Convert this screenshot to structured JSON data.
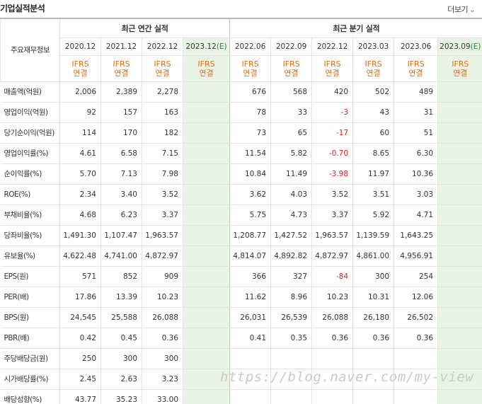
{
  "header": {
    "title": "기업실적분석",
    "more_label": "더보기",
    "more_icon": "chevron-down-icon"
  },
  "table": {
    "row_header": "주요재무정보",
    "group_annual": "최근 연간 실적",
    "group_quarterly": "최근 분기 실적",
    "annual_periods": [
      "2020.12",
      "2021.12",
      "2022.12",
      "2023.12"
    ],
    "annual_estimate_mark": "(E)",
    "quarterly_periods": [
      "2022.06",
      "2022.09",
      "2022.12",
      "2023.03",
      "2023.06",
      "2023.09"
    ],
    "quarterly_estimate_mark": "(E)",
    "ifrs_line1": "IFRS",
    "ifrs_line2": "연결",
    "rows": [
      {
        "label": "매출액(억원)",
        "annual": [
          "2,006",
          "2,389",
          "2,278",
          ""
        ],
        "quarterly": [
          "676",
          "568",
          "420",
          "502",
          "489",
          ""
        ]
      },
      {
        "label": "영업이익(억원)",
        "annual": [
          "92",
          "157",
          "163",
          ""
        ],
        "quarterly": [
          "78",
          "33",
          "-3",
          "43",
          "31",
          ""
        ]
      },
      {
        "label": "당기순이익(억원)",
        "annual": [
          "114",
          "170",
          "182",
          ""
        ],
        "quarterly": [
          "73",
          "65",
          "-17",
          "60",
          "51",
          ""
        ]
      },
      {
        "label": "영업이익률(%)",
        "annual": [
          "4.61",
          "6.58",
          "7.15",
          ""
        ],
        "quarterly": [
          "11.54",
          "5.82",
          "-0.70",
          "8.65",
          "6.30",
          ""
        ]
      },
      {
        "label": "순이익률(%)",
        "annual": [
          "5.70",
          "7.13",
          "7.98",
          ""
        ],
        "quarterly": [
          "10.84",
          "11.49",
          "-3.98",
          "11.97",
          "10.36",
          ""
        ]
      },
      {
        "label": "ROE(%)",
        "annual": [
          "2.34",
          "3.40",
          "3.52",
          ""
        ],
        "quarterly": [
          "3.62",
          "4.03",
          "3.52",
          "3.51",
          "3.03",
          ""
        ]
      },
      {
        "label": "부채비율(%)",
        "annual": [
          "4.68",
          "6.23",
          "3.37",
          ""
        ],
        "quarterly": [
          "5.75",
          "4.73",
          "3.37",
          "5.92",
          "4.71",
          ""
        ]
      },
      {
        "label": "당좌비율(%)",
        "annual": [
          "1,491.30",
          "1,107.47",
          "1,963.57",
          ""
        ],
        "quarterly": [
          "1,208.77",
          "1,427.52",
          "1,963.57",
          "1,139.59",
          "1,643.25",
          ""
        ]
      },
      {
        "label": "유보율(%)",
        "annual": [
          "4,622.48",
          "4,741.00",
          "4,872.97",
          ""
        ],
        "quarterly": [
          "4,814.07",
          "4,892.82",
          "4,872.97",
          "4,861.00",
          "4,956.91",
          ""
        ]
      },
      {
        "label": "EPS(원)",
        "annual": [
          "571",
          "852",
          "909",
          ""
        ],
        "quarterly": [
          "366",
          "327",
          "-84",
          "300",
          "254",
          ""
        ]
      },
      {
        "label": "PER(배)",
        "annual": [
          "17.86",
          "13.39",
          "10.23",
          ""
        ],
        "quarterly": [
          "11.62",
          "8.96",
          "10.23",
          "10.31",
          "12.06",
          ""
        ]
      },
      {
        "label": "BPS(원)",
        "annual": [
          "24,545",
          "25,588",
          "26,088",
          ""
        ],
        "quarterly": [
          "26,031",
          "26,539",
          "26,088",
          "26,180",
          "26,502",
          ""
        ]
      },
      {
        "label": "PBR(배)",
        "annual": [
          "0.42",
          "0.45",
          "0.36",
          ""
        ],
        "quarterly": [
          "0.41",
          "0.35",
          "0.36",
          "0.36",
          "0.36",
          ""
        ]
      },
      {
        "label": "주당배당금(원)",
        "annual": [
          "250",
          "300",
          "300",
          ""
        ],
        "quarterly": [
          "",
          "",
          "",
          "",
          "",
          ""
        ]
      },
      {
        "label": "시가배당률(%)",
        "annual": [
          "2.45",
          "2.63",
          "3.23",
          ""
        ],
        "quarterly": [
          "",
          "",
          "",
          "",
          "",
          ""
        ]
      },
      {
        "label": "배당성향(%)",
        "annual": [
          "43.77",
          "35.23",
          "33.00",
          ""
        ],
        "quarterly": [
          "",
          "",
          "",
          "",
          "",
          ""
        ]
      }
    ],
    "section_breaks_before": [
      3,
      6,
      9,
      13
    ],
    "colors": {
      "ifrs": "#e46d10",
      "estimate_bg": "#eaf4e6",
      "estimate_mark": "#2a8a2a",
      "negative": "#e02020"
    }
  },
  "watermark": "https://blog.naver.com/my-view"
}
